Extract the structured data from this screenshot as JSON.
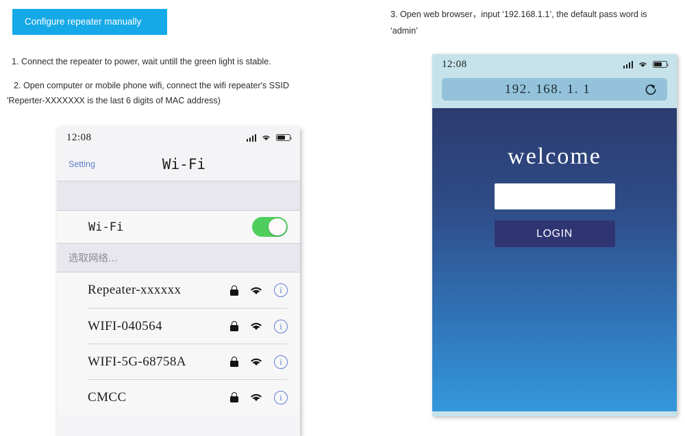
{
  "toolbar": {
    "configure_button": "Configure repeater manually",
    "accent_color": "#15a9e8"
  },
  "instructions": [
    {
      "id": "step1",
      "text": "1. Connect the repeater to power, wait untill the green light is stable."
    },
    {
      "id": "step2",
      "text": "2. Open computer or mobile phone wifi, connect the wifi repeater's SSID",
      "text_line2_a": "'Reperter-XXXXX",
      "text_line2_b": "X",
      "text_line2_c": "X is the last 6 digits of MAC address)"
    },
    {
      "id": "step3",
      "text": "3. Open web browser，input ‘192.168.1.1’, the default pass word is",
      "text_line2": "‘admin’"
    }
  ],
  "wifi_phone": {
    "status_bar": {
      "time": "12:08",
      "signal_icon": "signal-bars-icon",
      "wifi_icon": "wifi-icon",
      "battery_icon": "battery-icon"
    },
    "nav": {
      "back_label": "Setting",
      "title": "Wi-Fi"
    },
    "wifi_toggle": {
      "label": "Wi-Fi",
      "state": "on",
      "on_color": "#4fce5d"
    },
    "section_header": "选取网络...",
    "networks": [
      {
        "ssid": "Repeater-xxxxxx",
        "secured": true,
        "signal": "strong"
      },
      {
        "ssid": "WIFI-040564",
        "secured": true,
        "signal": "strong"
      },
      {
        "ssid": "WIFI-5G-68758A",
        "secured": true,
        "signal": "strong"
      },
      {
        "ssid": "CMCC",
        "secured": true,
        "signal": "strong"
      }
    ]
  },
  "browser_phone": {
    "status_bar": {
      "time": "12:08",
      "signal_icon": "signal-bars-icon",
      "wifi_icon": "wifi-icon",
      "battery_icon": "battery-icon"
    },
    "address_bar": {
      "url": "192. 168. 1. 1",
      "refresh_icon": "refresh-icon"
    },
    "login_page": {
      "heading": "welcome",
      "password_value": "",
      "password_placeholder": "",
      "login_button": "LOGIN",
      "gradient_top": "#2b3c70",
      "gradient_bottom": "#3498db",
      "button_color": "#2f3573"
    }
  }
}
